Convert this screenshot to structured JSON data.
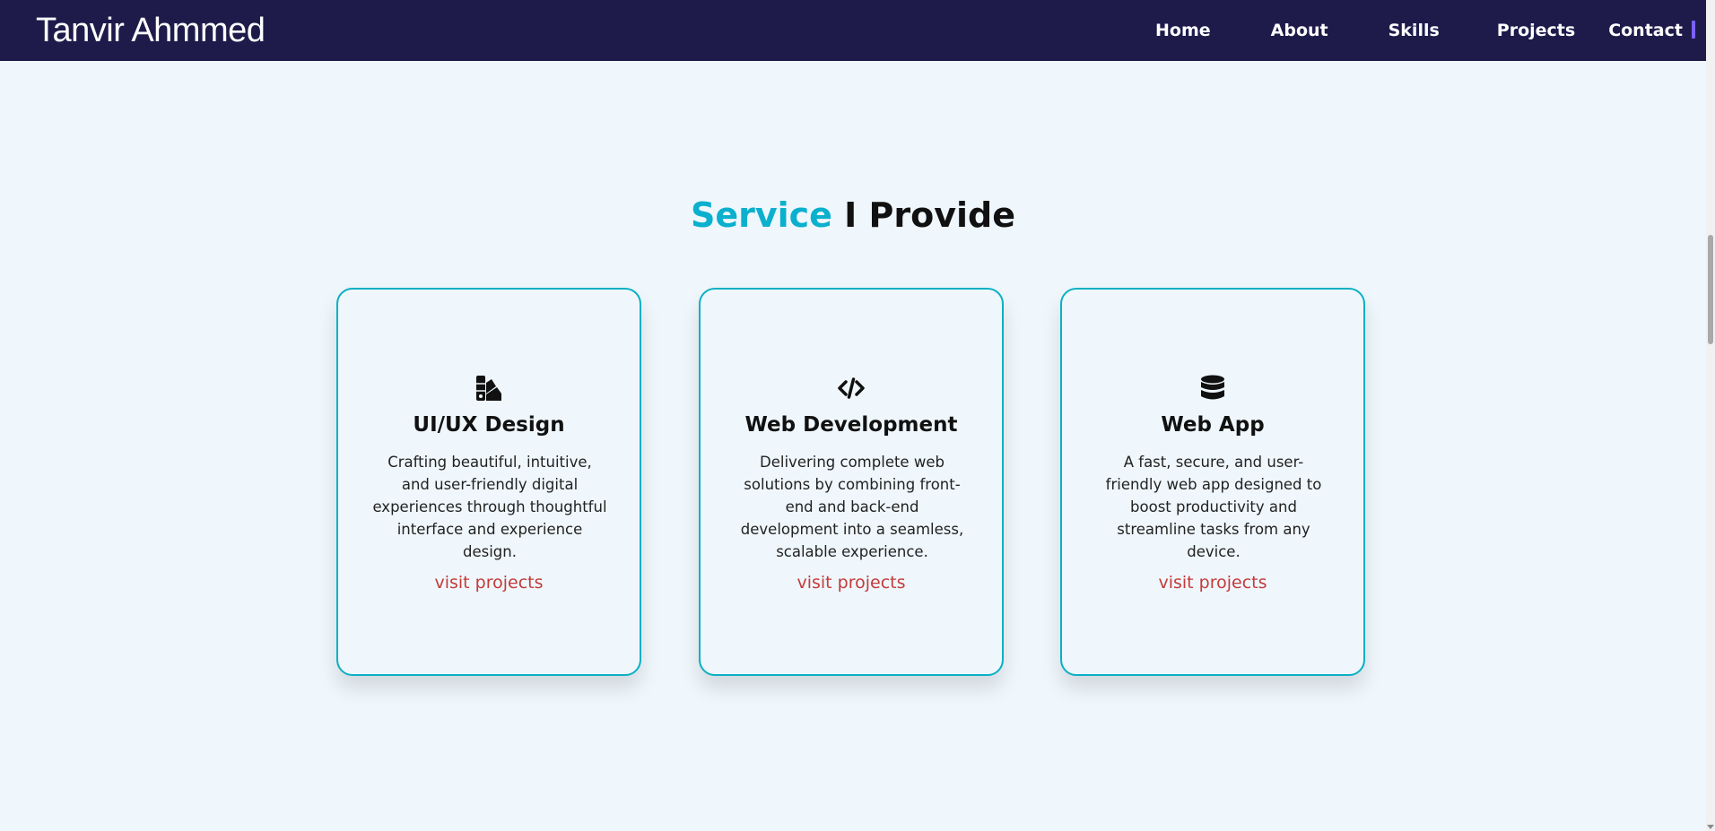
{
  "brand": {
    "name": "Tanvir Ahmmed"
  },
  "nav": {
    "items": [
      {
        "label": "Home"
      },
      {
        "label": "About"
      },
      {
        "label": "Skills"
      },
      {
        "label": "Projects"
      },
      {
        "label": "Contact"
      }
    ]
  },
  "section": {
    "title_accent": "Service",
    "title_rest": " I Provide"
  },
  "services": [
    {
      "icon": "swatchbook-icon",
      "title": "UI/UX Design",
      "description": "Crafting beautiful, intuitive, and user-friendly digital experiences through thoughtful interface and experience design.",
      "link": "visit projects"
    },
    {
      "icon": "code-icon",
      "title": "Web Development",
      "description": "Delivering complete web solutions by combining front-end and back-end development into a seamless, scalable experience.",
      "link": "visit projects"
    },
    {
      "icon": "database-icon",
      "title": "Web App",
      "description": "A fast, secure, and user-friendly web app designed to boost productivity and streamline tasks from any device.",
      "link": "visit projects"
    }
  ],
  "colors": {
    "navbar_bg": "#1e1b4b",
    "page_bg": "#eff7fc",
    "accent": "#0ab0cd",
    "card_border": "#0ab0c4",
    "link": "#c43a3a",
    "cursor": "#7b61ff"
  }
}
